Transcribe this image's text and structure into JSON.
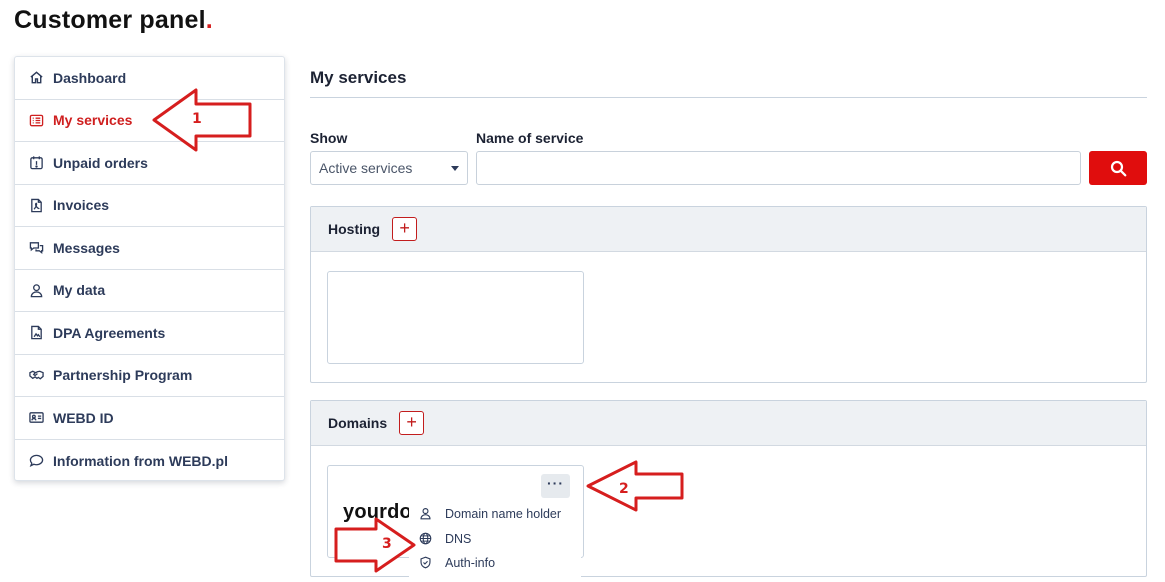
{
  "header": {
    "title": "Customer panel",
    "title_dot": "."
  },
  "sidebar": {
    "items": [
      {
        "label": "Dashboard",
        "icon": "home-icon",
        "active": false
      },
      {
        "label": "My services",
        "icon": "list-icon",
        "active": true
      },
      {
        "label": "Unpaid orders",
        "icon": "calendar-alert-icon",
        "active": false
      },
      {
        "label": "Invoices",
        "icon": "pdf-file-icon",
        "active": false
      },
      {
        "label": "Messages",
        "icon": "chat-bubbles-icon",
        "active": false
      },
      {
        "label": "My data",
        "icon": "user-icon",
        "active": false
      },
      {
        "label": "DPA Agreements",
        "icon": "document-icon",
        "active": false
      },
      {
        "label": "Partnership Program",
        "icon": "handshake-icon",
        "active": false
      },
      {
        "label": "WEBD ID",
        "icon": "id-card-icon",
        "active": false
      },
      {
        "label": "Information from WEBD.pl",
        "icon": "speech-bubble-icon",
        "active": false
      }
    ]
  },
  "main": {
    "title": "My services",
    "filters": {
      "show_label": "Show",
      "show_value": "Active services",
      "name_label": "Name of service",
      "name_value": ""
    },
    "sections": {
      "hosting": {
        "title": "Hosting",
        "add_label": "+"
      },
      "domains": {
        "title": "Domains",
        "add_label": "+"
      }
    },
    "domain_card": {
      "logo_text": "yourdo",
      "menu_button": "···",
      "menu_items": [
        {
          "label": "Domain name holder",
          "icon": "user-icon"
        },
        {
          "label": "DNS",
          "icon": "globe-icon"
        },
        {
          "label": "Auth-info",
          "icon": "shield-check-icon"
        }
      ]
    }
  },
  "annotations": [
    {
      "number": "1"
    },
    {
      "number": "2"
    },
    {
      "number": "3"
    }
  ],
  "colors": {
    "accent_red": "#e00d0d",
    "active_text": "#cf1f1f",
    "nav_text": "#2d3b5a",
    "arrow_red": "#d61e1e"
  }
}
